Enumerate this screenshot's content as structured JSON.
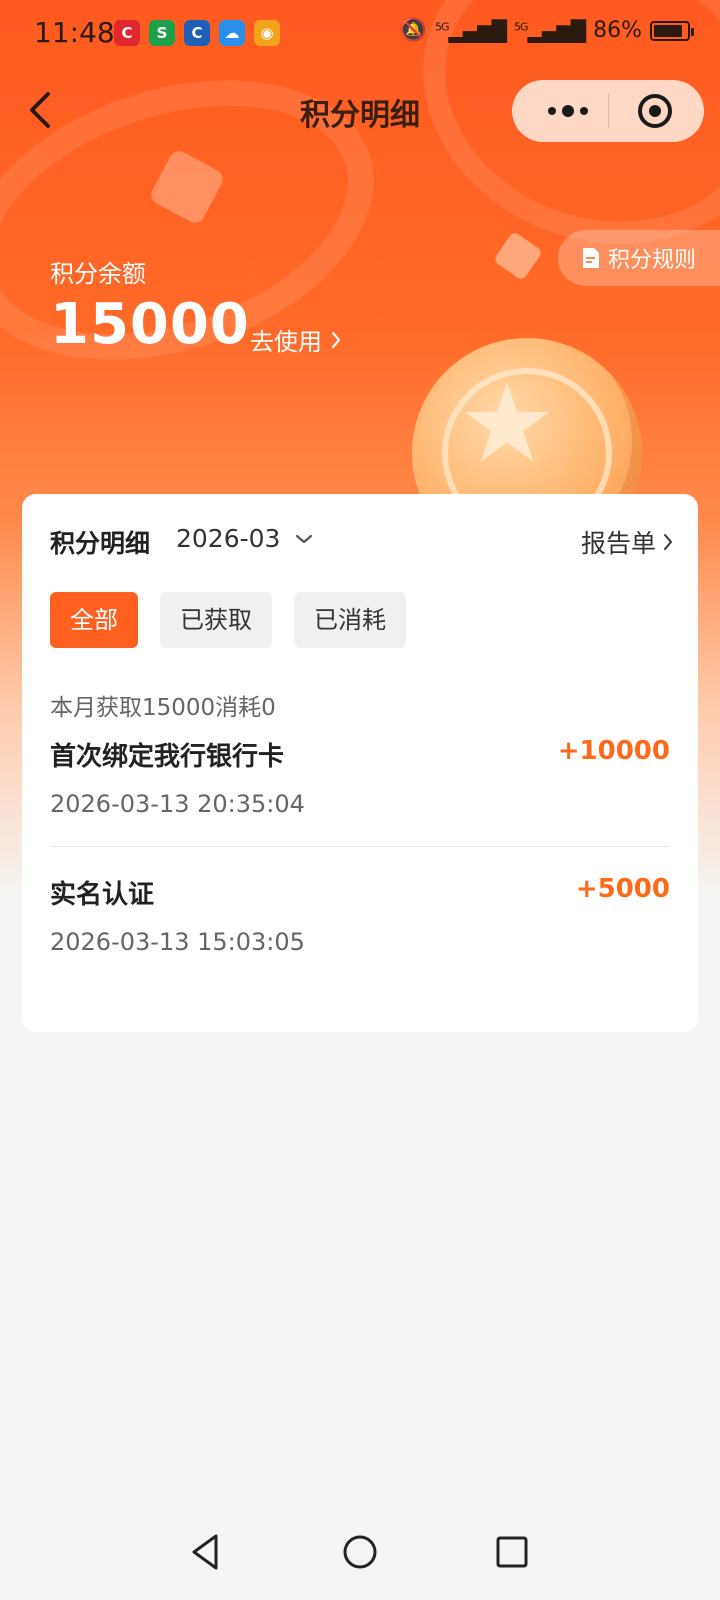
{
  "status_bar": {
    "time": "11:48",
    "network_1": "5G",
    "network_2": "5G",
    "battery": "86%",
    "battery_level": 0.86,
    "apps": [
      {
        "icon": "c-app-icon",
        "glyph": "C",
        "color": "#e0262f"
      },
      {
        "icon": "s-app-icon",
        "glyph": "S",
        "color": "#1da04a"
      },
      {
        "icon": "ccb-app-icon",
        "glyph": "C",
        "color": "#1f5fb8"
      },
      {
        "icon": "cloud-app-icon",
        "glyph": "☁",
        "color": "#2a8fea"
      },
      {
        "icon": "game-app-icon",
        "glyph": "◉",
        "color": "#f2a21b"
      }
    ]
  },
  "nav": {
    "title": "积分明细"
  },
  "rules_link": {
    "label": "积分规则"
  },
  "balance": {
    "label": "积分余额",
    "value": "15000",
    "use_label": "去使用"
  },
  "card": {
    "title": "积分明细",
    "month": "2026-03",
    "report_label": "报告单",
    "filters": [
      {
        "label": "全部",
        "active": true
      },
      {
        "label": "已获取",
        "active": false
      },
      {
        "label": "已消耗",
        "active": false
      }
    ],
    "summary": "本月获取15000消耗0",
    "records": [
      {
        "title": "首次绑定我行银行卡",
        "amount": "+10000",
        "time": "2026-03-13 20:35:04"
      },
      {
        "title": "实名认证",
        "amount": "+5000",
        "time": "2026-03-13 15:03:05"
      }
    ]
  },
  "colors": {
    "accent": "#ff5f1f",
    "amount": "#ff6a1a"
  }
}
